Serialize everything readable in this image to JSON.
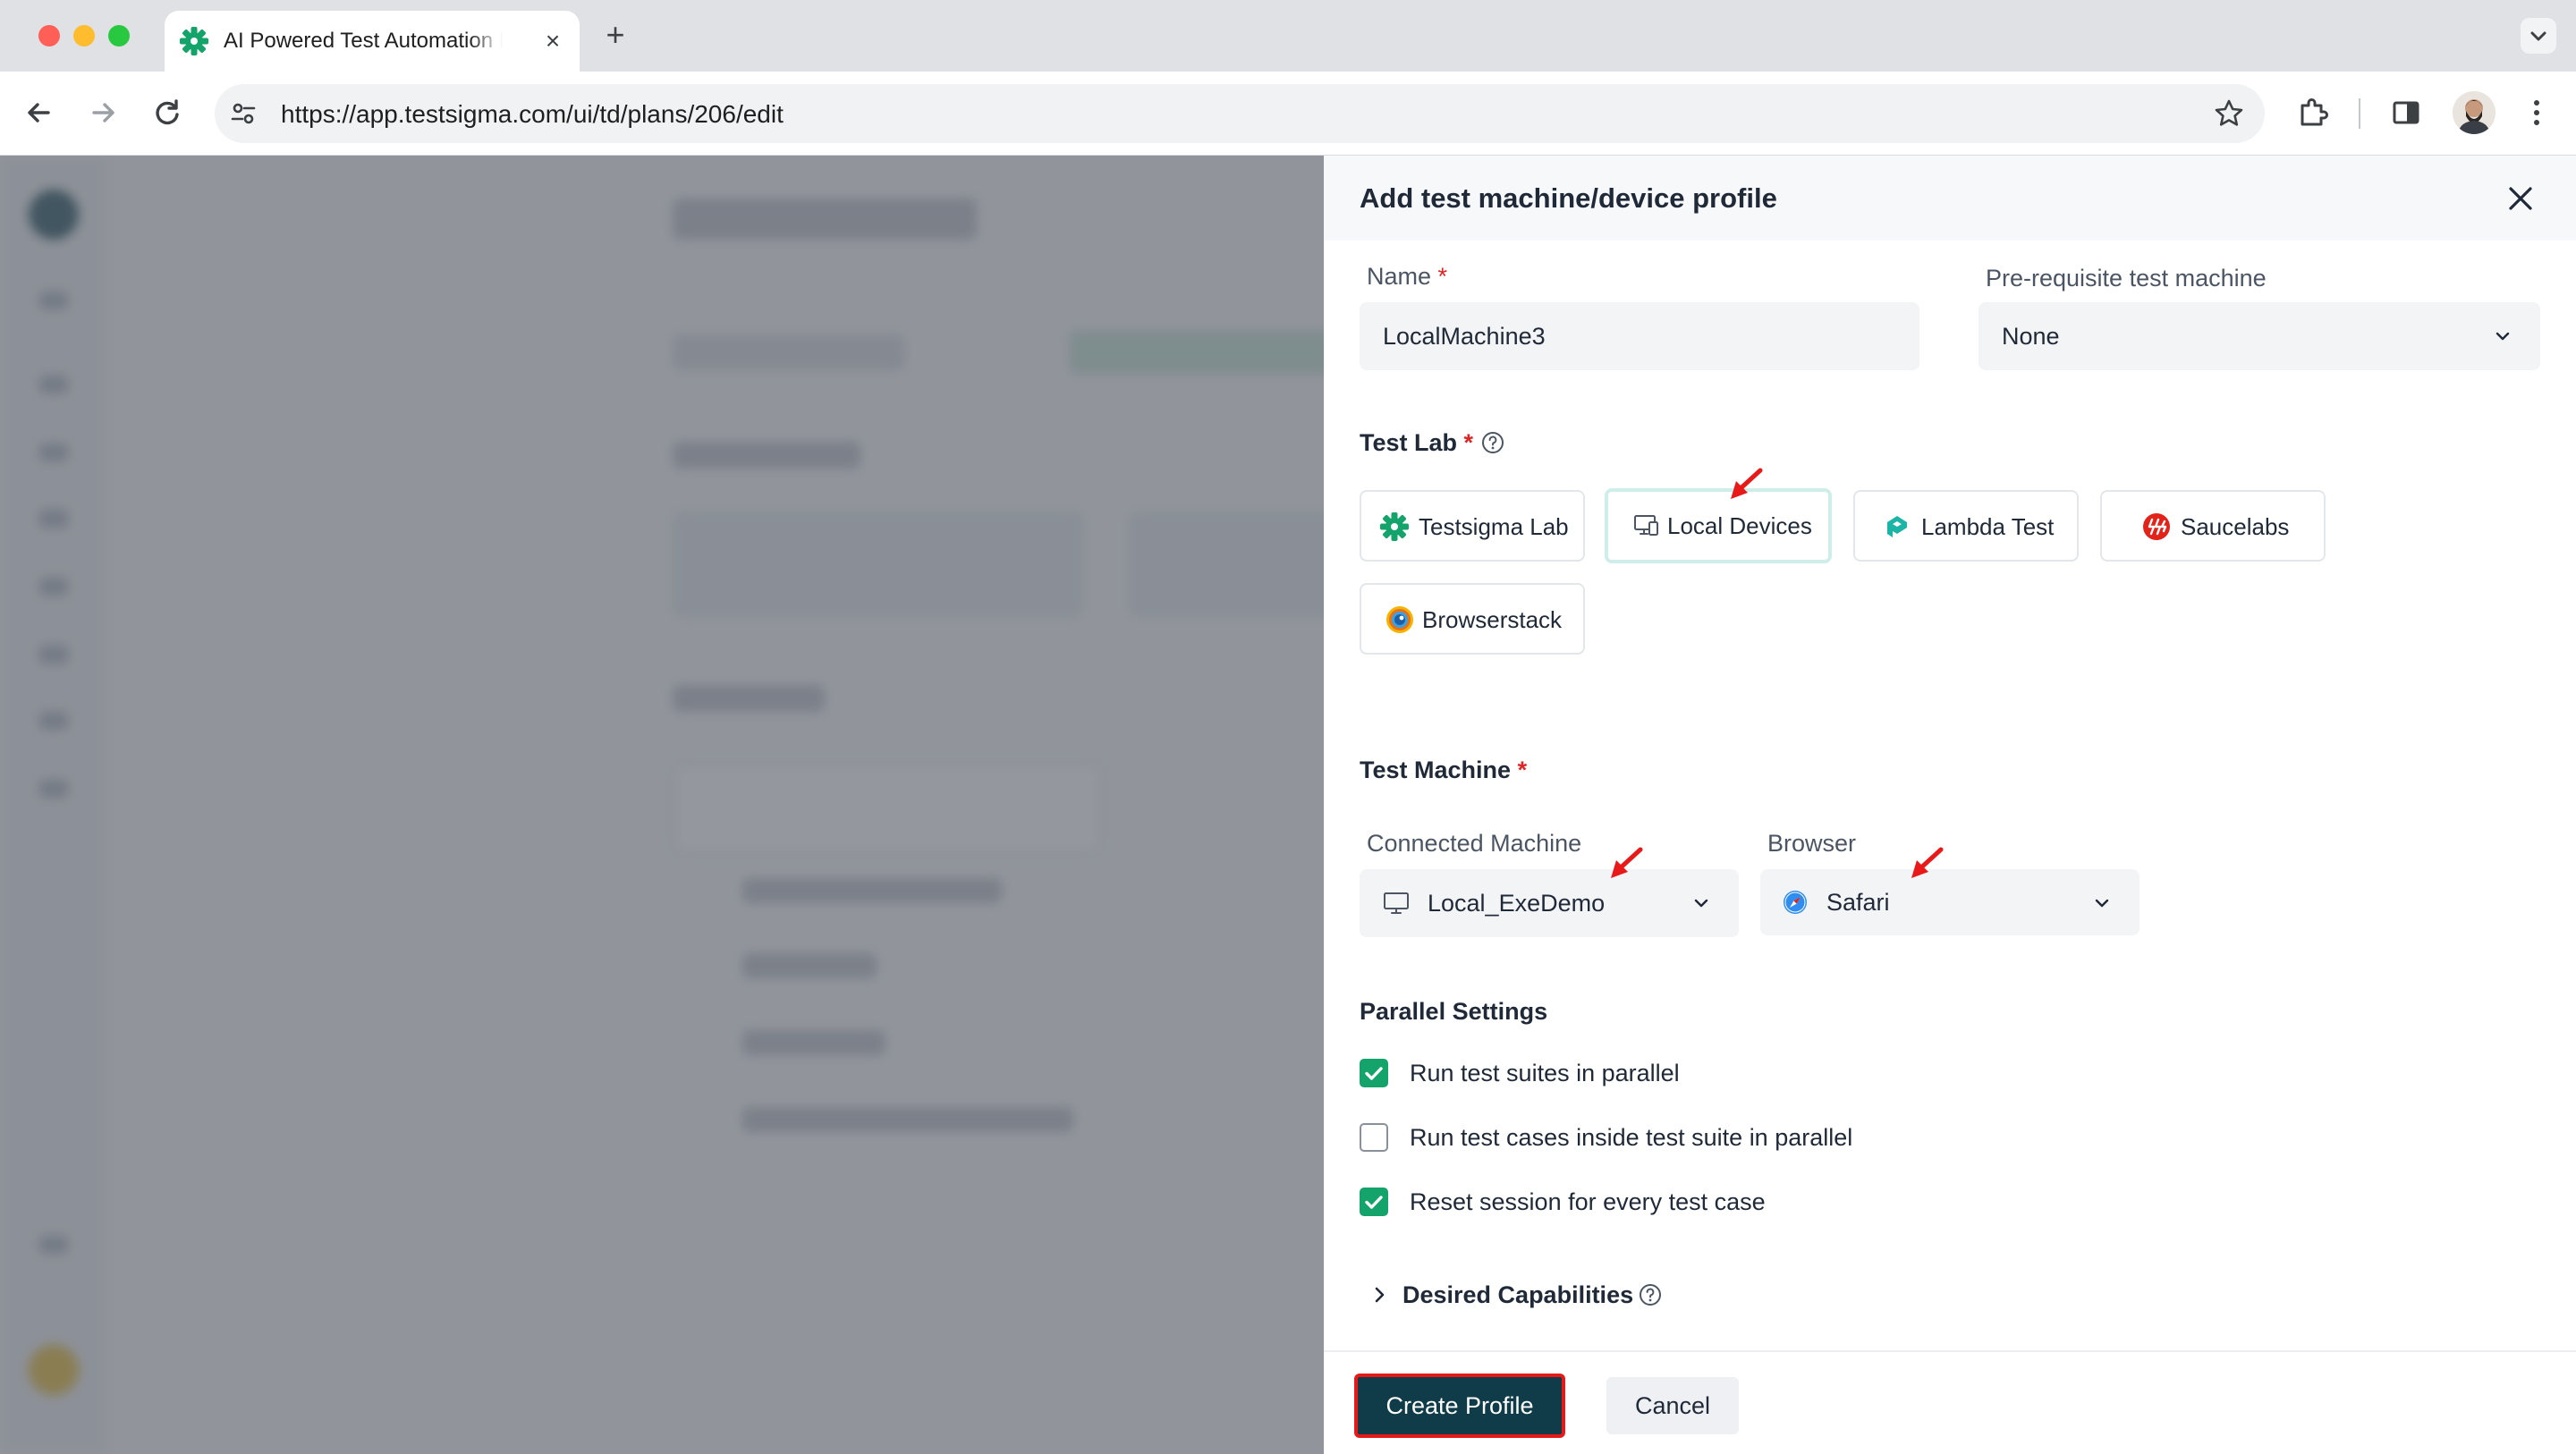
{
  "browser": {
    "tab_title": "AI Powered Test Automation Platform",
    "tab_close": "×",
    "new_tab": "+",
    "url": "https://app.testsigma.com/ui/td/plans/206/edit"
  },
  "drawer": {
    "title": "Add test machine/device profile",
    "name_label": "Name",
    "name_value": "LocalMachine3",
    "prereq_label": "Pre-requisite test machine",
    "prereq_value": "None",
    "test_lab_label": "Test Lab",
    "required_mark": "*",
    "labs": [
      {
        "label": "Testsigma Lab",
        "icon": "testsigma-gear-icon",
        "selected": false
      },
      {
        "label": "Local Devices",
        "icon": "local-devices-icon",
        "selected": true
      },
      {
        "label": "Lambda Test",
        "icon": "lambdatest-icon",
        "selected": false
      },
      {
        "label": "Saucelabs",
        "icon": "saucelabs-icon",
        "selected": false
      },
      {
        "label": "Browserstack",
        "icon": "browserstack-icon",
        "selected": false
      }
    ],
    "test_machine_label": "Test Machine",
    "connected_machine_label": "Connected Machine",
    "connected_machine_value": "Local_ExeDemo",
    "browser_label": "Browser",
    "browser_value": "Safari",
    "parallel_label": "Parallel Settings",
    "checkboxes": [
      {
        "label": "Run test suites in parallel",
        "checked": true
      },
      {
        "label": "Run test cases inside test suite in parallel",
        "checked": false
      },
      {
        "label": "Reset session for every test case",
        "checked": true
      }
    ],
    "desired_capabilities_label": "Desired Capabilities",
    "create_button": "Create Profile",
    "cancel_button": "Cancel"
  },
  "colors": {
    "primary": "#0f3c48",
    "check": "#14a36a",
    "required": "#e02424",
    "annotation": "#e81919",
    "selected_border": "#cfeeea"
  }
}
